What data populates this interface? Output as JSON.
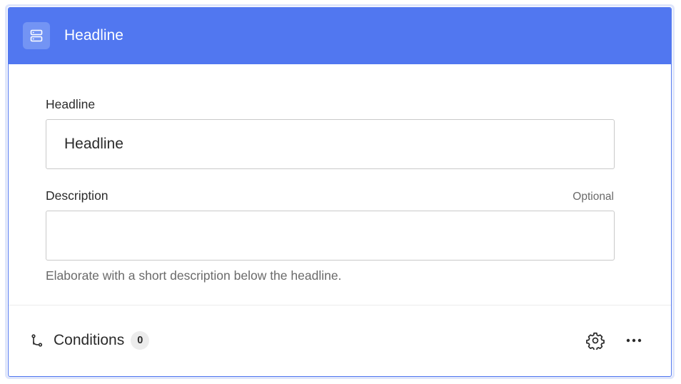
{
  "header": {
    "icon": "server-icon",
    "title": "Headline"
  },
  "fields": {
    "headline": {
      "label": "Headline",
      "value": "Headline",
      "placeholder": ""
    },
    "description": {
      "label": "Description",
      "optional_label": "Optional",
      "value": "",
      "placeholder": "",
      "hint": "Elaborate with a short description below the headline."
    }
  },
  "footer": {
    "conditions_icon": "branch-icon",
    "conditions_label": "Conditions",
    "conditions_count": "0",
    "settings_icon": "gear-icon",
    "more_icon": "more-horizontal-icon"
  },
  "colors": {
    "accent": "#5177f0",
    "header_icon_bg": "#7394f4",
    "card_border": "#5076ef"
  }
}
